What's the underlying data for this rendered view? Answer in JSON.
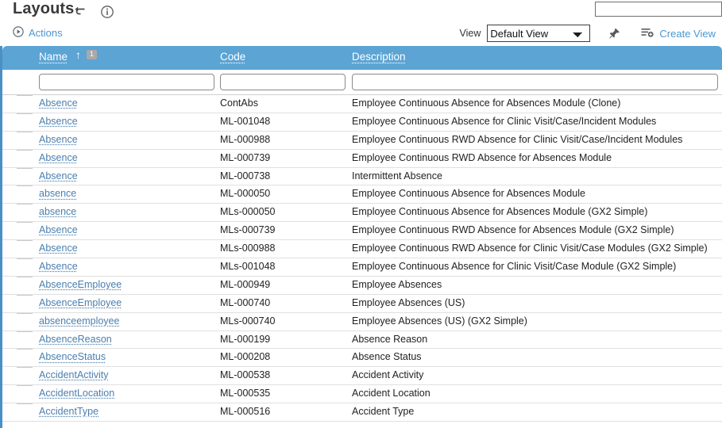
{
  "header": {
    "title": "Layouts",
    "return_icon": "return-arrow-icon",
    "info_icon": "info-icon",
    "search_value": "",
    "search_placeholder": ""
  },
  "toolbar": {
    "actions_label": "Actions",
    "actions_icon": "play-circle-icon",
    "view_label": "View",
    "view_selected": "Default View",
    "view_options": [
      "Default View"
    ],
    "pin_icon": "pin-icon",
    "create_view_label": "Create View",
    "create_view_icon": "list-add-icon"
  },
  "grid": {
    "columns": [
      {
        "key": "name",
        "label": "Name",
        "sorted": true,
        "sort_direction": "ascending",
        "sort_order_badge": "1"
      },
      {
        "key": "code",
        "label": "Code",
        "sorted": false
      },
      {
        "key": "description",
        "label": "Description",
        "sorted": false
      }
    ],
    "filters": {
      "name": "",
      "code": "",
      "description": ""
    },
    "rows": [
      {
        "name": "Absence",
        "code": "ContAbs",
        "description": "Employee Continuous Absence for Absences Module (Clone)"
      },
      {
        "name": "Absence",
        "code": "ML-001048",
        "description": "Employee Continuous Absence for Clinic Visit/Case/Incident Modules"
      },
      {
        "name": "Absence",
        "code": "ML-000988",
        "description": "Employee Continuous RWD Absence for Clinic Visit/Case/Incident Modules"
      },
      {
        "name": "Absence",
        "code": "ML-000739",
        "description": "Employee Continuous RWD Absence for Absences Module"
      },
      {
        "name": "Absence",
        "code": "ML-000738",
        "description": "Intermittent Absence"
      },
      {
        "name": "absence",
        "code": "ML-000050",
        "description": "Employee Continuous Absence for Absences Module"
      },
      {
        "name": "absence",
        "code": "MLs-000050",
        "description": "Employee Continuous Absence for Absences Module (GX2 Simple)"
      },
      {
        "name": "Absence",
        "code": "MLs-000739",
        "description": "Employee Continuous RWD Absence for Absences Module (GX2 Simple)"
      },
      {
        "name": "Absence",
        "code": "MLs-000988",
        "description": "Employee Continuous RWD Absence for Clinic Visit/Case Modules (GX2 Simple)"
      },
      {
        "name": "Absence",
        "code": "MLs-001048",
        "description": "Employee Continuous Absence for Clinic Visit/Case Module (GX2 Simple)"
      },
      {
        "name": "AbsenceEmployee",
        "code": "ML-000949",
        "description": "Employee Absences"
      },
      {
        "name": "AbsenceEmployee",
        "code": "ML-000740",
        "description": "Employee Absences (US)"
      },
      {
        "name": "absenceemployee",
        "code": "MLs-000740",
        "description": "Employee Absences (US) (GX2 Simple)"
      },
      {
        "name": "AbsenceReason",
        "code": "ML-000199",
        "description": "Absence Reason"
      },
      {
        "name": "AbsenceStatus",
        "code": "ML-000208",
        "description": "Absence Status"
      },
      {
        "name": "AccidentActivity",
        "code": "ML-000538",
        "description": "Accident Activity"
      },
      {
        "name": "AccidentLocation",
        "code": "ML-000535",
        "description": "Accident Location"
      },
      {
        "name": "AccidentType",
        "code": "ML-000516",
        "description": "Accident Type"
      }
    ]
  },
  "colors": {
    "header_blue": "#5ba4d4",
    "accent_left_border": "#4a90c4",
    "link_blue": "#4b97d2",
    "cell_link": "#4b7fae",
    "badge_gray": "#a9a9a9"
  }
}
